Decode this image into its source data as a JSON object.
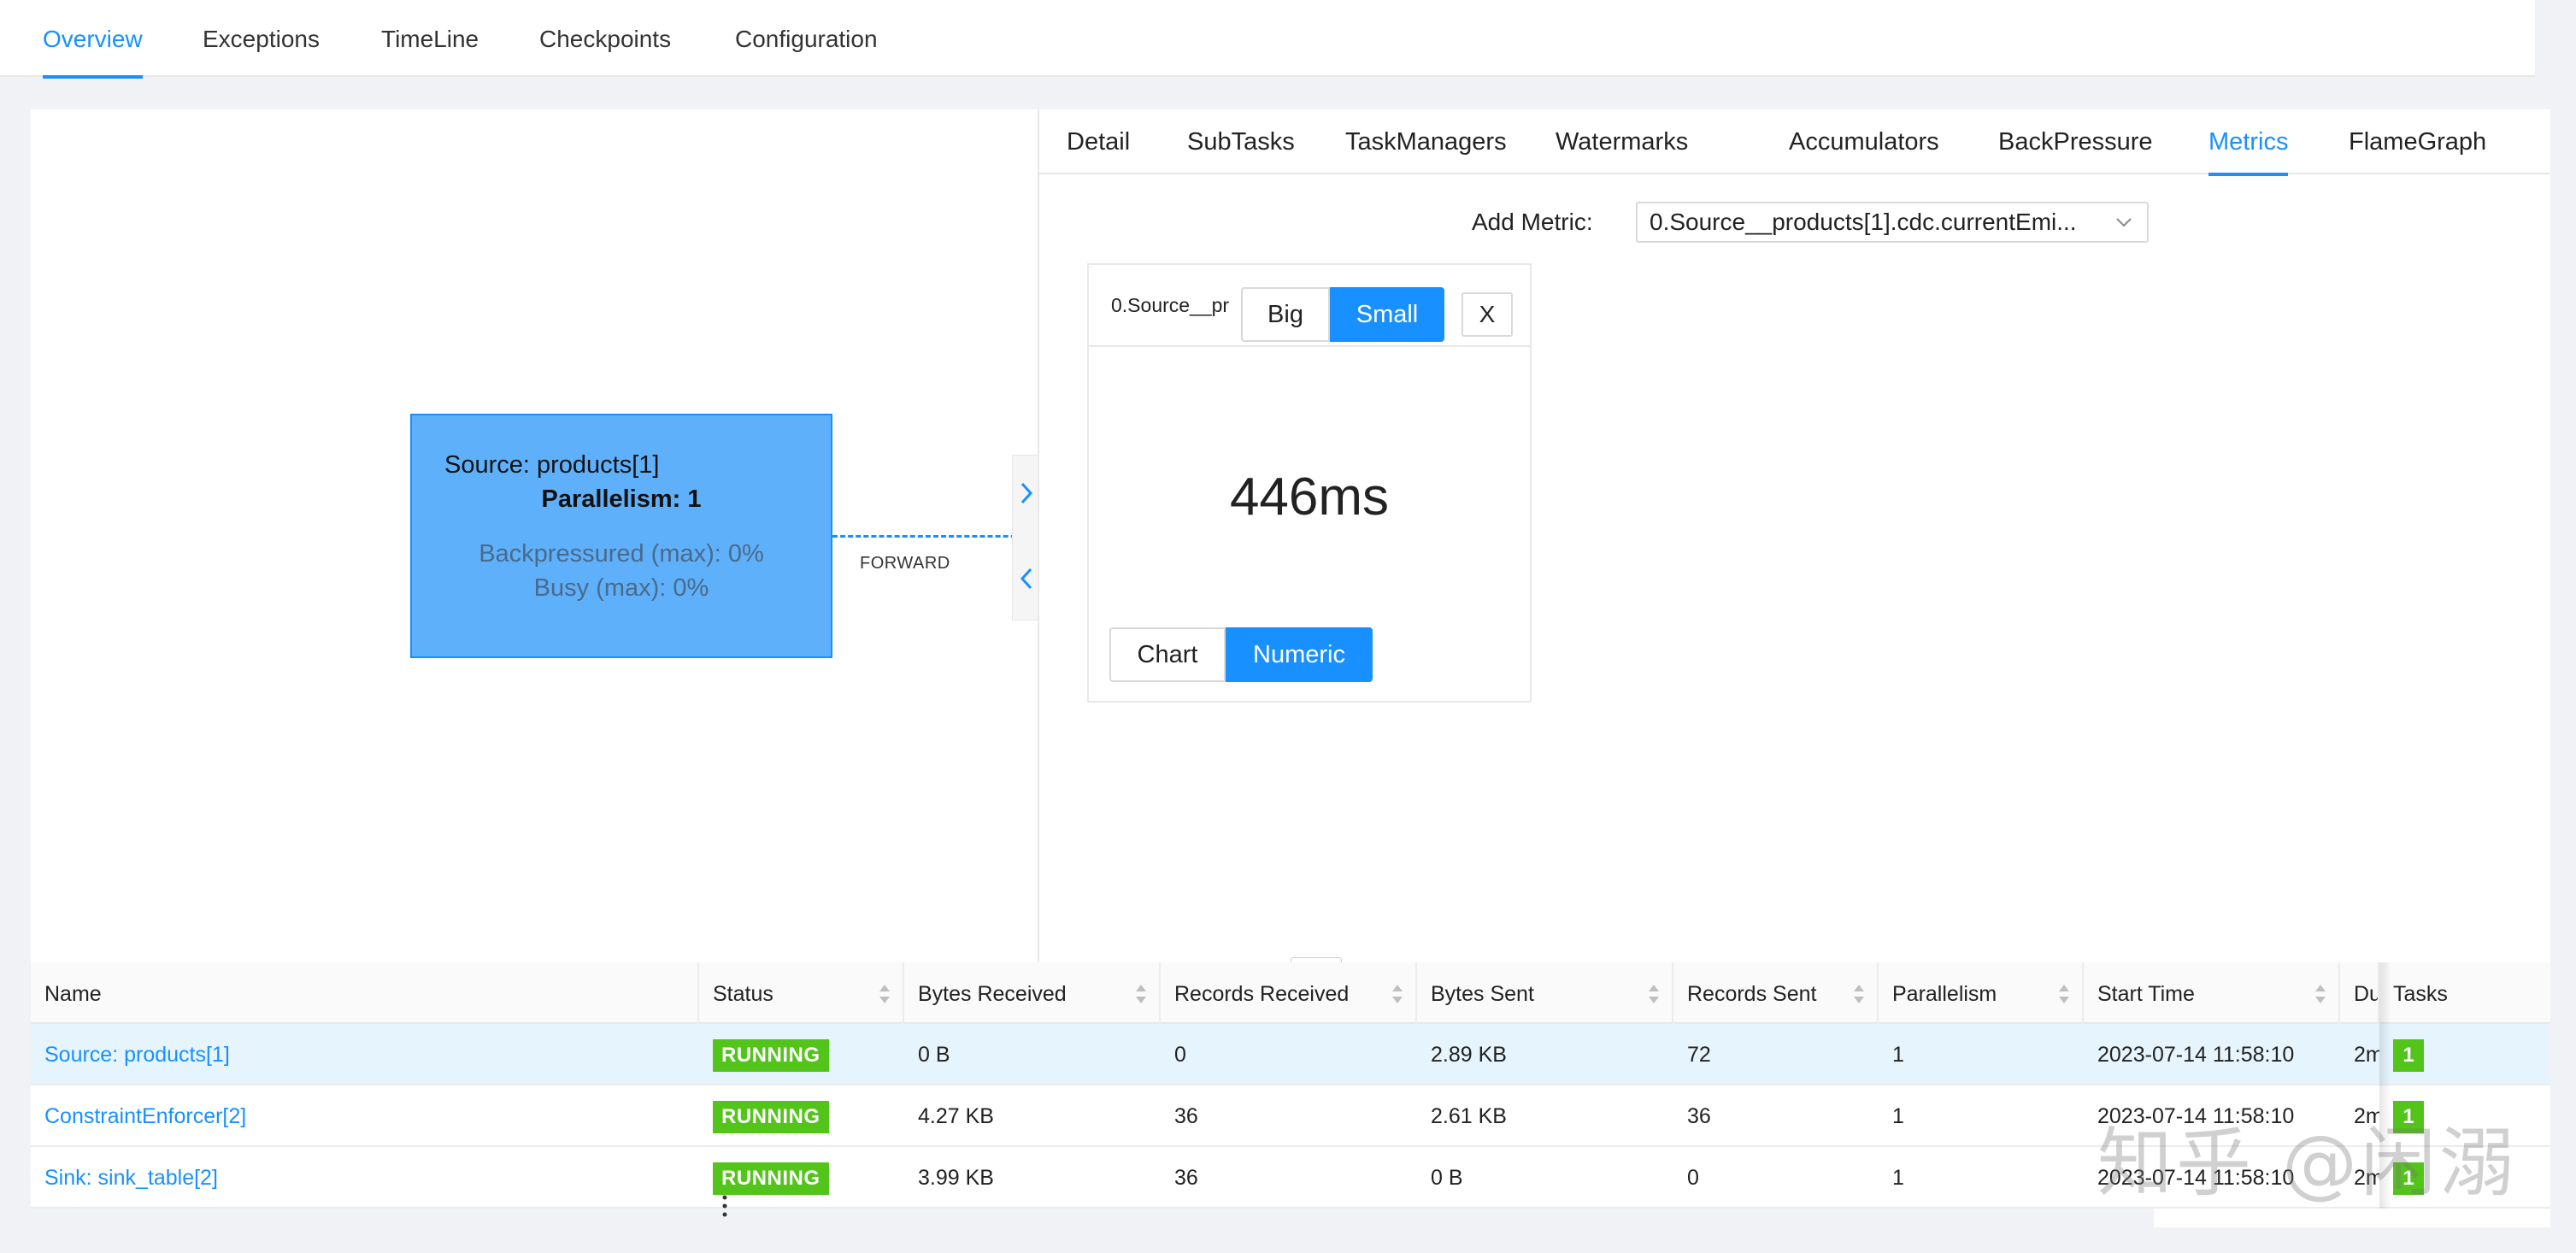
{
  "topnav": {
    "tabs": [
      {
        "label": "Overview",
        "active": true
      },
      {
        "label": "Exceptions",
        "active": false
      },
      {
        "label": "TimeLine",
        "active": false
      },
      {
        "label": "Checkpoints",
        "active": false
      },
      {
        "label": "Configuration",
        "active": false
      }
    ]
  },
  "graph": {
    "node": {
      "title": "Source: products[1]",
      "parallelism": "Parallelism: 1",
      "backpressured": "Backpressured (max): 0%",
      "busy": "Busy (max): 0%",
      "color": "#5fb0fb"
    },
    "edge_label": "FORWARD"
  },
  "subtabs": {
    "tabs": [
      {
        "label": "Detail",
        "active": false
      },
      {
        "label": "SubTasks",
        "active": false
      },
      {
        "label": "TaskManagers",
        "active": false
      },
      {
        "label": "Watermarks",
        "active": false
      },
      {
        "label": "Accumulators",
        "active": false
      },
      {
        "label": "BackPressure",
        "active": false
      },
      {
        "label": "Metrics",
        "active": true
      },
      {
        "label": "FlameGraph",
        "active": false
      }
    ]
  },
  "metrics": {
    "add_label": "Add Metric:",
    "selected_metric": "0.Source__products[1].cdc.currentEmi...",
    "card": {
      "name": "0.Source__pr",
      "big_label": "Big",
      "small_label": "Small",
      "close_label": "X",
      "value": "446ms",
      "chart_label": "Chart",
      "numeric_label": "Numeric"
    }
  },
  "drag_handle": "...",
  "table": {
    "columns": [
      "Name",
      "Status",
      "Bytes Received",
      "Records Received",
      "Bytes Sent",
      "Records Sent",
      "Parallelism",
      "Start Time",
      "Du",
      "Tasks"
    ],
    "rows": [
      {
        "name": "Source: products[1]",
        "status": "RUNNING",
        "bytes_received": "0 B",
        "records_received": "0",
        "bytes_sent": "2.89 KB",
        "records_sent": "72",
        "parallelism": "1",
        "start_time": "2023-07-14 11:58:10",
        "duration": "2m",
        "tasks": "1"
      },
      {
        "name": "ConstraintEnforcer[2]",
        "status": "RUNNING",
        "bytes_received": "4.27 KB",
        "records_received": "36",
        "bytes_sent": "2.61 KB",
        "records_sent": "36",
        "parallelism": "1",
        "start_time": "2023-07-14 11:58:10",
        "duration": "2m",
        "tasks": "1"
      },
      {
        "name": "Sink: sink_table[2]",
        "status": "RUNNING",
        "bytes_received": "3.99 KB",
        "records_received": "36",
        "bytes_sent": "0 B",
        "records_sent": "0",
        "parallelism": "1",
        "start_time": "2023-07-14 11:58:10",
        "duration": "2m",
        "tasks": "1"
      }
    ]
  },
  "watermark": "知乎 @闲溺",
  "colors": {
    "accent": "#1890ff",
    "running": "#52c41a",
    "highlight_row": "#e6f4fd"
  },
  "icons": {
    "expand": "chevron-right-icon",
    "collapse": "chevron-left-icon",
    "dropdown": "chevron-down-icon",
    "sort": "sort-icon"
  }
}
